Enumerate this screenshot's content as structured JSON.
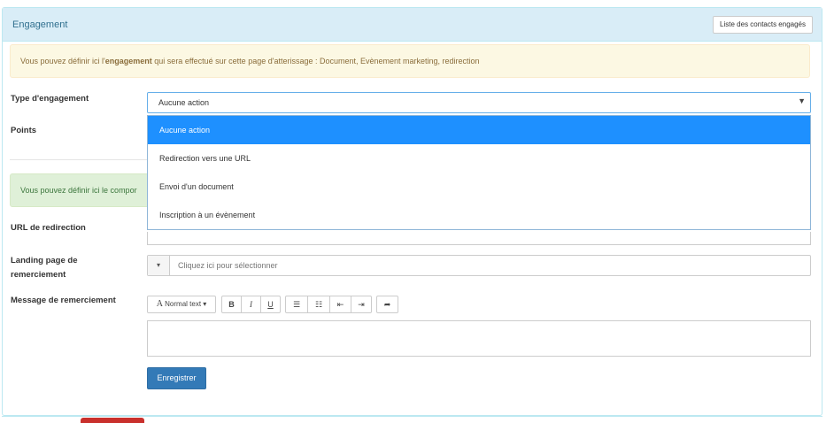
{
  "panel": {
    "title": "Engagement",
    "contacts_button": "Liste des contacts engagés"
  },
  "alert_info": {
    "prefix": "Vous pouvez définir ici l'",
    "bold": "engagement",
    "suffix": " qui sera effectué sur cette page d'atterissage : Document, Evènement marketing, redirection"
  },
  "alert_success": {
    "text": "Vous pouvez définir ici le compor"
  },
  "form": {
    "type_label": "Type d'engagement",
    "points_label": "Points",
    "url_label": "URL de redirection",
    "landing_label_1": "Landing page de",
    "landing_label_2": "remerciement",
    "message_label": "Message de remerciement",
    "type_value": "Aucune action",
    "landing_placeholder": "Cliquez ici pour sélectionner",
    "save_button": "Enregistrer"
  },
  "dropdown": {
    "options": [
      "Aucune action",
      "Redirection vers une URL",
      "Envoi d'un document",
      "Inscription à un évènement"
    ],
    "selected_index": 0
  },
  "toolbar": {
    "style_label": "Normal text",
    "bold": "B",
    "italic": "I",
    "underline": "U"
  },
  "colors": {
    "heading_bg": "#d9edf7",
    "selected_option": "#1e90ff",
    "primary_button": "#337ab7"
  }
}
